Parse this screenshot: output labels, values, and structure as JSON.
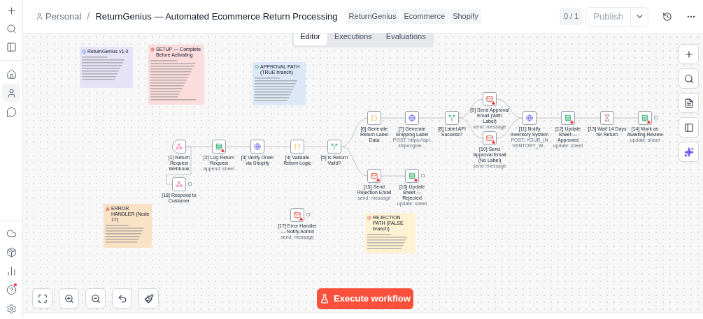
{
  "sidebar": {
    "items": [
      {
        "kind": "new",
        "selected": false,
        "dot": false
      },
      {
        "kind": "search",
        "selected": false,
        "dot": false
      },
      {
        "kind": "panel",
        "selected": false,
        "dot": false
      },
      {
        "kind": "home",
        "selected": false,
        "dot": false
      },
      {
        "kind": "person",
        "selected": true,
        "dot": false
      },
      {
        "kind": "chat",
        "selected": false,
        "dot": false
      }
    ],
    "bottom_items": [
      {
        "kind": "cloud",
        "selected": false,
        "dot": false
      },
      {
        "kind": "package",
        "selected": false,
        "dot": false
      },
      {
        "kind": "chart",
        "selected": false,
        "dot": false
      },
      {
        "kind": "help",
        "selected": false,
        "dot": true
      },
      {
        "kind": "settings",
        "selected": false,
        "dot": false
      }
    ]
  },
  "header": {
    "breadcrumb": "Personal",
    "separator": "/",
    "title": "ReturnGenius — Automated Ecommerce Return Processing",
    "tags": [
      "ReturnGenius",
      "Ecommerce",
      "Shopify"
    ],
    "counter": "0 / 1",
    "publish": "Publish"
  },
  "tabs": [
    {
      "label": "Editor",
      "selected": true
    },
    {
      "label": "Executions",
      "selected": false
    },
    {
      "label": "Evaluations",
      "selected": false
    }
  ],
  "notes": [
    {
      "kind": "info",
      "color": "#e7e3f6",
      "title": "ReturnGenius v1.0"
    },
    {
      "kind": "setup",
      "color": "#fcdcdc",
      "title": "SETUP — Complete Before Activating"
    },
    {
      "kind": "approve",
      "color": "#dce8f7",
      "title": "APPROVAL PATH (TRUE branch)"
    },
    {
      "kind": "error",
      "color": "#f9e2c6",
      "title": "ERROR HANDLER (Node 17)"
    },
    {
      "kind": "reject",
      "color": "#fdf2d2",
      "title": "REJECTION PATH (FALSE branch)"
    }
  ],
  "nodes": [
    {
      "kind": "webhook",
      "label": "[1] Return Request Webhook",
      "warning": false,
      "trailing": false
    },
    {
      "kind": "sheets",
      "label": "[2] Log Return Request",
      "subtitle": "append: sheet",
      "warning": true,
      "trailing": false
    },
    {
      "kind": "http",
      "label": "[3] Verify Order via Shopify",
      "warning": false,
      "trailing": false
    },
    {
      "kind": "code",
      "label": "[4] Validate Return Logic",
      "warning": false,
      "trailing": false
    },
    {
      "kind": "if",
      "label": "[5] Is Return Valid?",
      "warning": false,
      "trailing": false
    },
    {
      "kind": "code",
      "label": "[6] Generate Return Label Data",
      "warning": false,
      "trailing": false
    },
    {
      "kind": "http",
      "label": "[7] Generate Shipping Label",
      "subtitle": "POST: https://api.shipengine...",
      "warning": false,
      "trailing": false
    },
    {
      "kind": "if",
      "label": "[8] Label API Success?",
      "warning": false,
      "trailing": false
    },
    {
      "kind": "gmail",
      "label": "[9] Send Approval Email (With Label)",
      "subtitle": "send: message",
      "warning": true,
      "trailing": false
    },
    {
      "kind": "gmail",
      "label": "[10] Send Approval Email (No Label)",
      "subtitle": "send: message",
      "warning": true,
      "trailing": false
    },
    {
      "kind": "http",
      "label": "[11] Notify Inventory System",
      "subtitle": "POST: YOUR_INVENTORY_W...",
      "warning": false,
      "trailing": false
    },
    {
      "kind": "sheets",
      "label": "[12] Update Sheet — Approved",
      "subtitle": "update: sheet",
      "warning": true,
      "trailing": false
    },
    {
      "kind": "wait",
      "label": "[13] Wait 14 Days for Return",
      "warning": false,
      "trailing": false
    },
    {
      "kind": "sheets",
      "label": "[14] Mark as Awaiting Review",
      "subtitle": "update: sheet",
      "warning": true,
      "trailing": true
    },
    {
      "kind": "gmail",
      "label": "[15] Send Rejection Email",
      "subtitle": "send: message",
      "warning": true,
      "trailing": false
    },
    {
      "kind": "sheets",
      "label": "[16] Update Sheet — Rejected",
      "subtitle": "update: sheet",
      "warning": true,
      "trailing": true
    },
    {
      "kind": "gmail",
      "label": "[17] Error Handler — Notify Admin",
      "subtitle": "send: message",
      "warning": true,
      "trailing": true
    },
    {
      "kind": "respond",
      "label": "[18] Respond to Customer",
      "warning": false,
      "trailing": true
    }
  ],
  "execute_button": "Execute workflow"
}
